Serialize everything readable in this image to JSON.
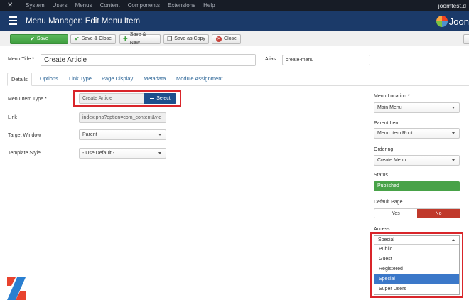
{
  "navbar": {
    "menu": [
      "System",
      "Users",
      "Menus",
      "Content",
      "Components",
      "Extensions",
      "Help"
    ],
    "site": "joomtest.d"
  },
  "header": {
    "title": "Menu Manager: Edit Menu Item",
    "brand": "Joon"
  },
  "toolbar": {
    "save": "Save",
    "save_close": "Save & Close",
    "save_new": "Save & New",
    "save_copy": "Save as Copy",
    "close": "Close"
  },
  "form": {
    "menu_title_label": "Menu Title *",
    "menu_title_value": "Create Article",
    "alias_label": "Alias",
    "alias_value": "create-menu"
  },
  "tabs": [
    "Details",
    "Options",
    "Link Type",
    "Page Display",
    "Metadata",
    "Module Assignment"
  ],
  "details": {
    "type_label": "Menu Item Type *",
    "type_value": "Create Article",
    "select_label": "Select",
    "link_label": "Link",
    "link_value": "index.php?option=com_content&vie",
    "target_label": "Target Window",
    "target_value": "Parent",
    "template_label": "Template Style",
    "template_value": "- Use Default -"
  },
  "sidebar": {
    "location_label": "Menu Location *",
    "location_value": "Main Menu",
    "parent_label": "Parent Item",
    "parent_value": "Menu Item Root",
    "ordering_label": "Ordering",
    "ordering_value": "Create Menu",
    "status_label": "Status",
    "status_value": "Published",
    "default_label": "Default Page",
    "default_yes": "Yes",
    "default_no": "No",
    "access_label": "Access",
    "access_value": "Special",
    "access_options": [
      "Public",
      "Guest",
      "Registered",
      "Special",
      "Super Users"
    ]
  },
  "colors": {
    "navbar": "#171c26",
    "header": "#1b3a69",
    "save_green": "#48a248",
    "highlight": "#d9252a",
    "select_blue": "#1d4f8c"
  }
}
